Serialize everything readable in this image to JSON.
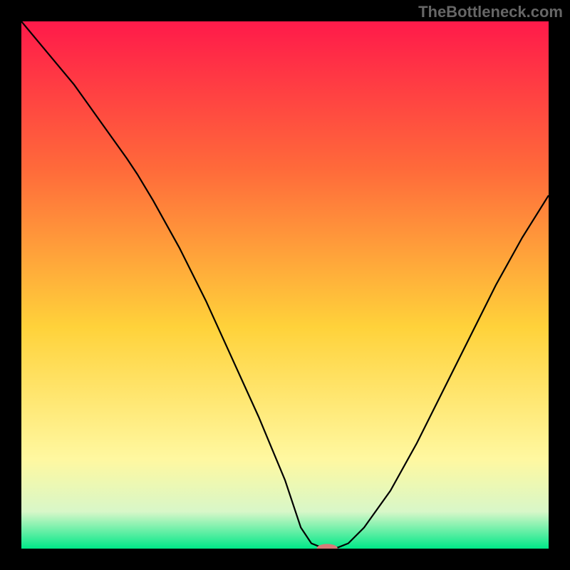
{
  "watermark": "TheBottleneck.com",
  "colors": {
    "frame": "#000000",
    "gradient_top": "#ff1a4a",
    "gradient_mid_upper": "#ff6a3a",
    "gradient_mid": "#ffd23a",
    "gradient_lower": "#fff8a0",
    "gradient_bottom_pale": "#d8f7c8",
    "gradient_bottom": "#00e888",
    "curve": "#000000",
    "marker": "#d77a78"
  },
  "chart_data": {
    "type": "line",
    "title": "",
    "xlabel": "",
    "ylabel": "",
    "xlim": [
      0,
      100
    ],
    "ylim": [
      0,
      100
    ],
    "series": [
      {
        "name": "bottleneck-curve",
        "x": [
          0,
          5,
          10,
          15,
          20,
          22,
          25,
          30,
          35,
          40,
          45,
          50,
          53,
          55,
          57,
          58,
          60,
          62,
          65,
          70,
          75,
          80,
          85,
          90,
          95,
          100
        ],
        "y": [
          100,
          94,
          88,
          81,
          74,
          71,
          66,
          57,
          47,
          36,
          25,
          13,
          4,
          1,
          0.2,
          0,
          0.2,
          1,
          4,
          11,
          20,
          30,
          40,
          50,
          59,
          67
        ]
      }
    ],
    "marker": {
      "x": 58,
      "y": 0,
      "rx": 2.0,
      "ry": 0.9
    }
  }
}
